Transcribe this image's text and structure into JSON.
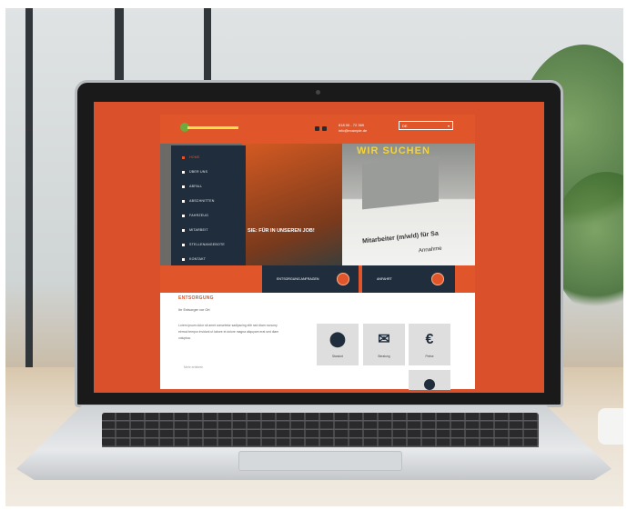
{
  "header": {
    "contact_line1": "818 00 - 72 369",
    "contact_line2": "info@example.de",
    "language": "DE",
    "language_chevron": "▾"
  },
  "hero": {
    "banner_text": "WIR SUCHEN",
    "overlay_text": "SIE: FÜR IN UNSEREN JOB!",
    "headline": "Mitarbeiter (m/w/d) für Sa",
    "subline": "Annahme"
  },
  "menu": {
    "items": [
      {
        "label": "HOME",
        "icon": "square-bullet"
      },
      {
        "label": "ÜBER UNS",
        "icon": "square-bullet"
      },
      {
        "label": "ABFALL",
        "icon": "square-bullet"
      },
      {
        "label": "ABSCHNITTEN",
        "icon": "square-bullet"
      },
      {
        "label": "FAHRZEUG",
        "icon": "square-bullet"
      },
      {
        "label": "MITARBEIT",
        "icon": "square-bullet"
      },
      {
        "label": "STELLENANGEBOTE",
        "icon": "square-bullet"
      },
      {
        "label": "KONTAKT",
        "icon": "square-bullet"
      }
    ],
    "active_index": 0
  },
  "cta": {
    "left_label": "ENTSORGUNG ANFRAGEN",
    "right_label": "ANFAHRT"
  },
  "section": {
    "title": "ENTSORGUNG",
    "subtitle": "Ihr Entsorger vor Ort",
    "body": "Lorem ipsum dolor sit amet consetetur sadipscing elitr sed diam nonumy eirmod tempor invidunt ut labore et dolore magna aliquyam erat sed diam voluptua.",
    "link": "Mehr erfahren"
  },
  "tiles": [
    {
      "icon": "location-pin-icon",
      "glyph": "⬤",
      "label": "Standort"
    },
    {
      "icon": "chat-bubbles-icon",
      "glyph": "✉",
      "label": "Beratung"
    },
    {
      "icon": "euro-icon",
      "glyph": "€",
      "label": "Preise"
    }
  ],
  "colors": {
    "brand_orange": "#e0552a",
    "navy": "#1f2d3d"
  }
}
